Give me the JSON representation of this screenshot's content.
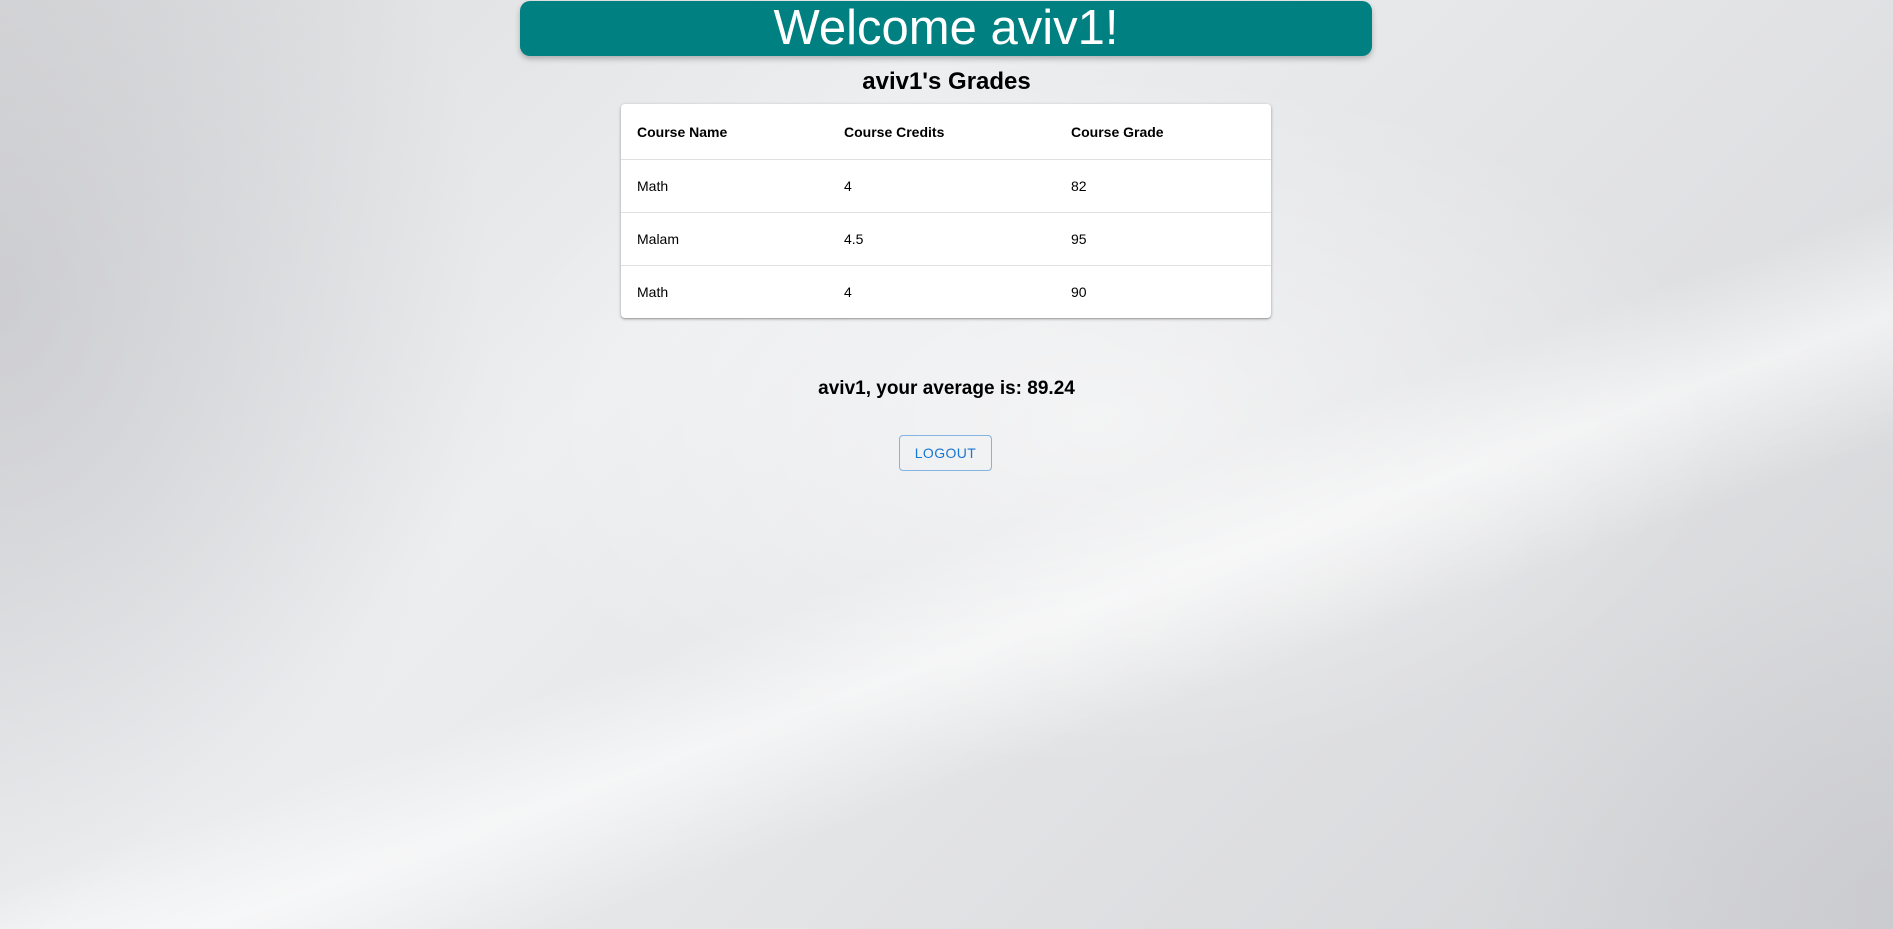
{
  "header": {
    "title": "Welcome aviv1!"
  },
  "grades": {
    "title": "aviv1's Grades",
    "columns": [
      "Course Name",
      "Course Credits",
      "Course Grade"
    ],
    "rows": [
      [
        "Math",
        "4",
        "82"
      ],
      [
        "Malam",
        "4.5",
        "95"
      ],
      [
        "Math",
        "4",
        "90"
      ]
    ]
  },
  "summary": {
    "average_text": "aviv1, your average is: 89.24"
  },
  "actions": {
    "logout_label": "LOGOUT"
  },
  "colors": {
    "header_bg": "#008080",
    "button_accent": "#1976d2"
  }
}
